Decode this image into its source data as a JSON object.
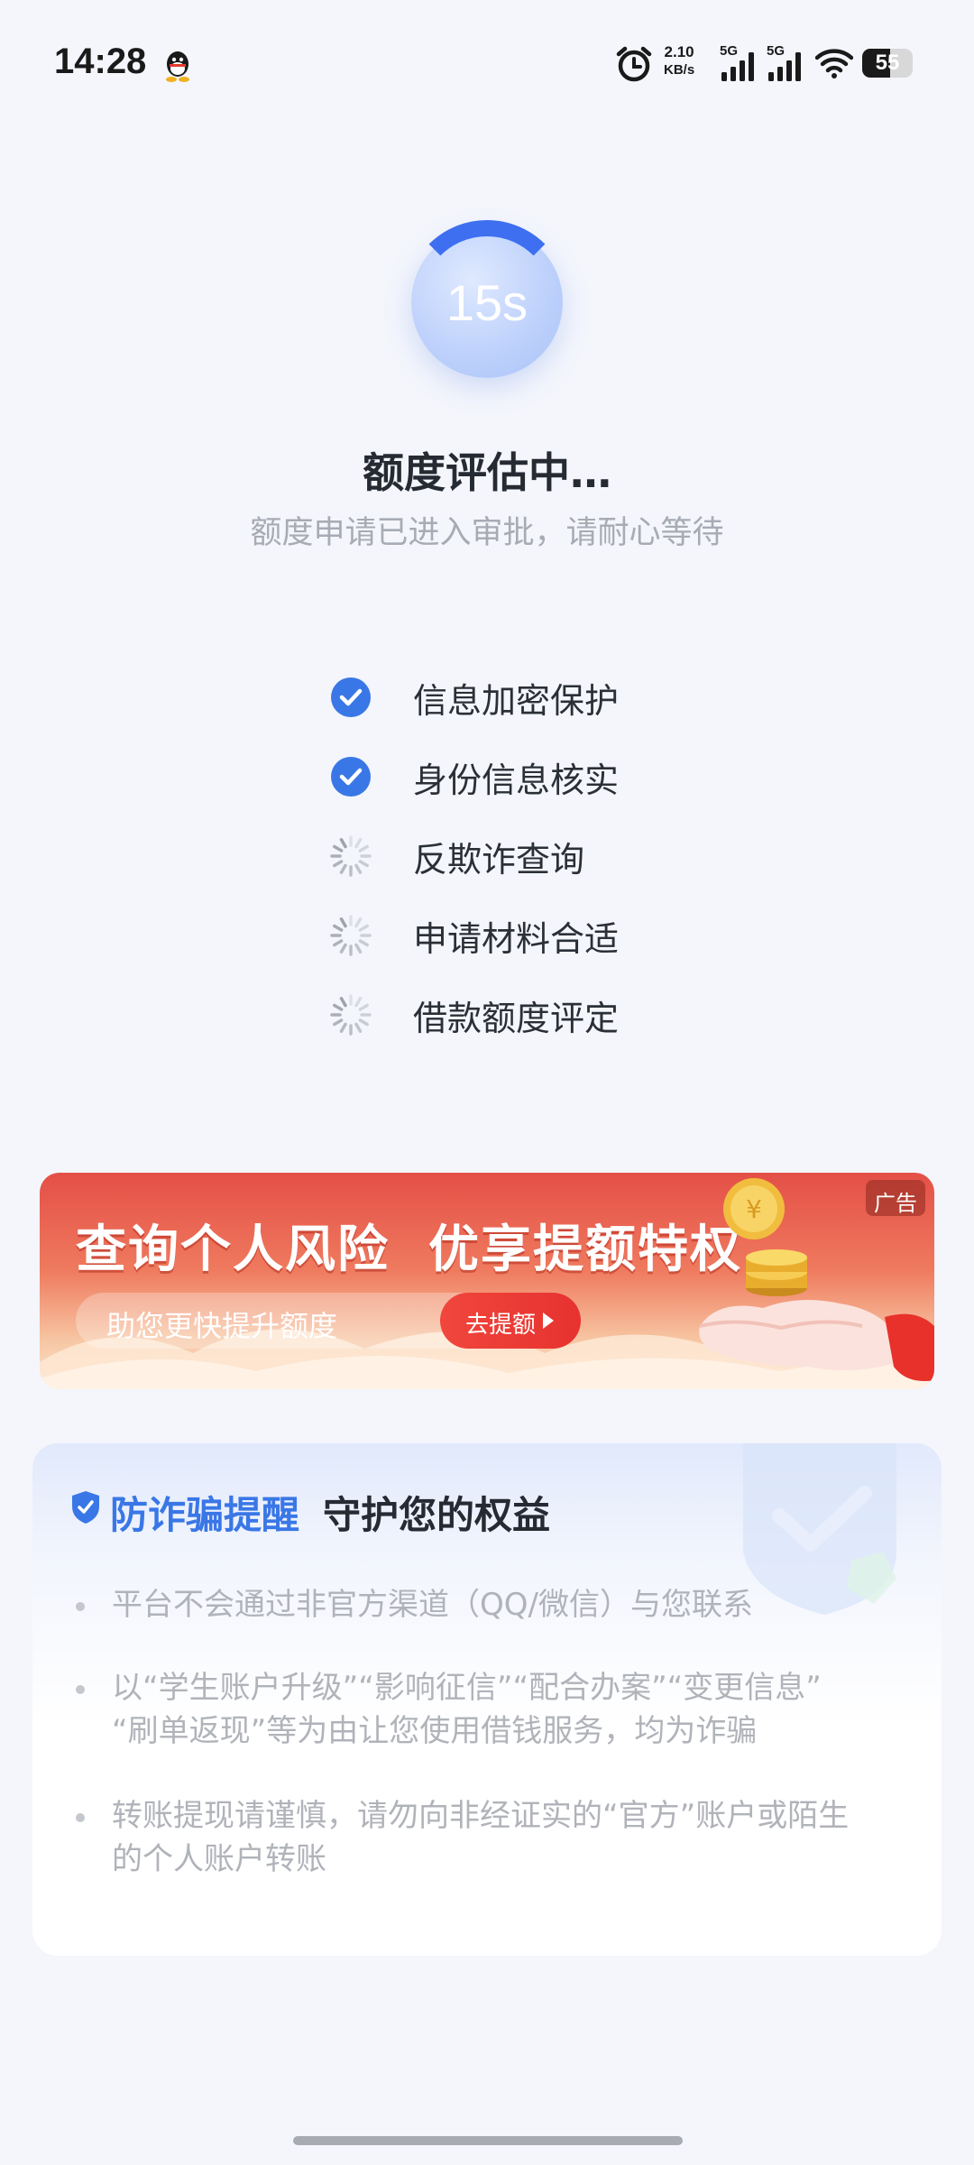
{
  "status_bar": {
    "time": "14:28",
    "net_speed_value": "2.10",
    "net_speed_unit": "KB/s",
    "sim1_label": "5G",
    "sim2_label": "5G",
    "battery": "55",
    "battery_level": 0.55
  },
  "timer": {
    "text": "15s",
    "progress": 0.25
  },
  "header": {
    "title": "额度评估中…",
    "subtitle": "额度申请已进入审批，请耐心等待"
  },
  "steps": [
    {
      "label": "信息加密保护",
      "status": "done"
    },
    {
      "label": "身份信息核实",
      "status": "done"
    },
    {
      "label": "反欺诈查询",
      "status": "loading"
    },
    {
      "label": "申请材料合适",
      "status": "loading"
    },
    {
      "label": "借款额度评定",
      "status": "loading"
    }
  ],
  "ad": {
    "headline": "查询个人风险  优享提额特权",
    "subtext": "助您更快提升额度",
    "cta": "去提额",
    "tag": "广告"
  },
  "fraud_notice": {
    "title_highlight": "防诈骗提醒",
    "title_rest": "守护您的权益",
    "tips": [
      "平台不会通过非官方渠道（QQ/微信）与您联系",
      "以“学生账户升级”“影响征信”“配合办案”“变更信息”",
      "“刷单返现”等为由让您使用借钱服务，均为诈骗",
      "转账提现请谨慎，请勿向非经证实的“官方”账户或陌生",
      "的个人账户转账"
    ]
  },
  "colors": {
    "accent_blue": "#3a77e6",
    "ad_red": "#e44f47",
    "background": "#f4f6fc"
  },
  "icons": [
    "qq-icon",
    "alarm-icon",
    "signal-icon",
    "wifi-icon",
    "battery-icon",
    "check-circle-icon",
    "loading-spinner-icon",
    "shield-check-icon",
    "coins-hand-illustration"
  ]
}
